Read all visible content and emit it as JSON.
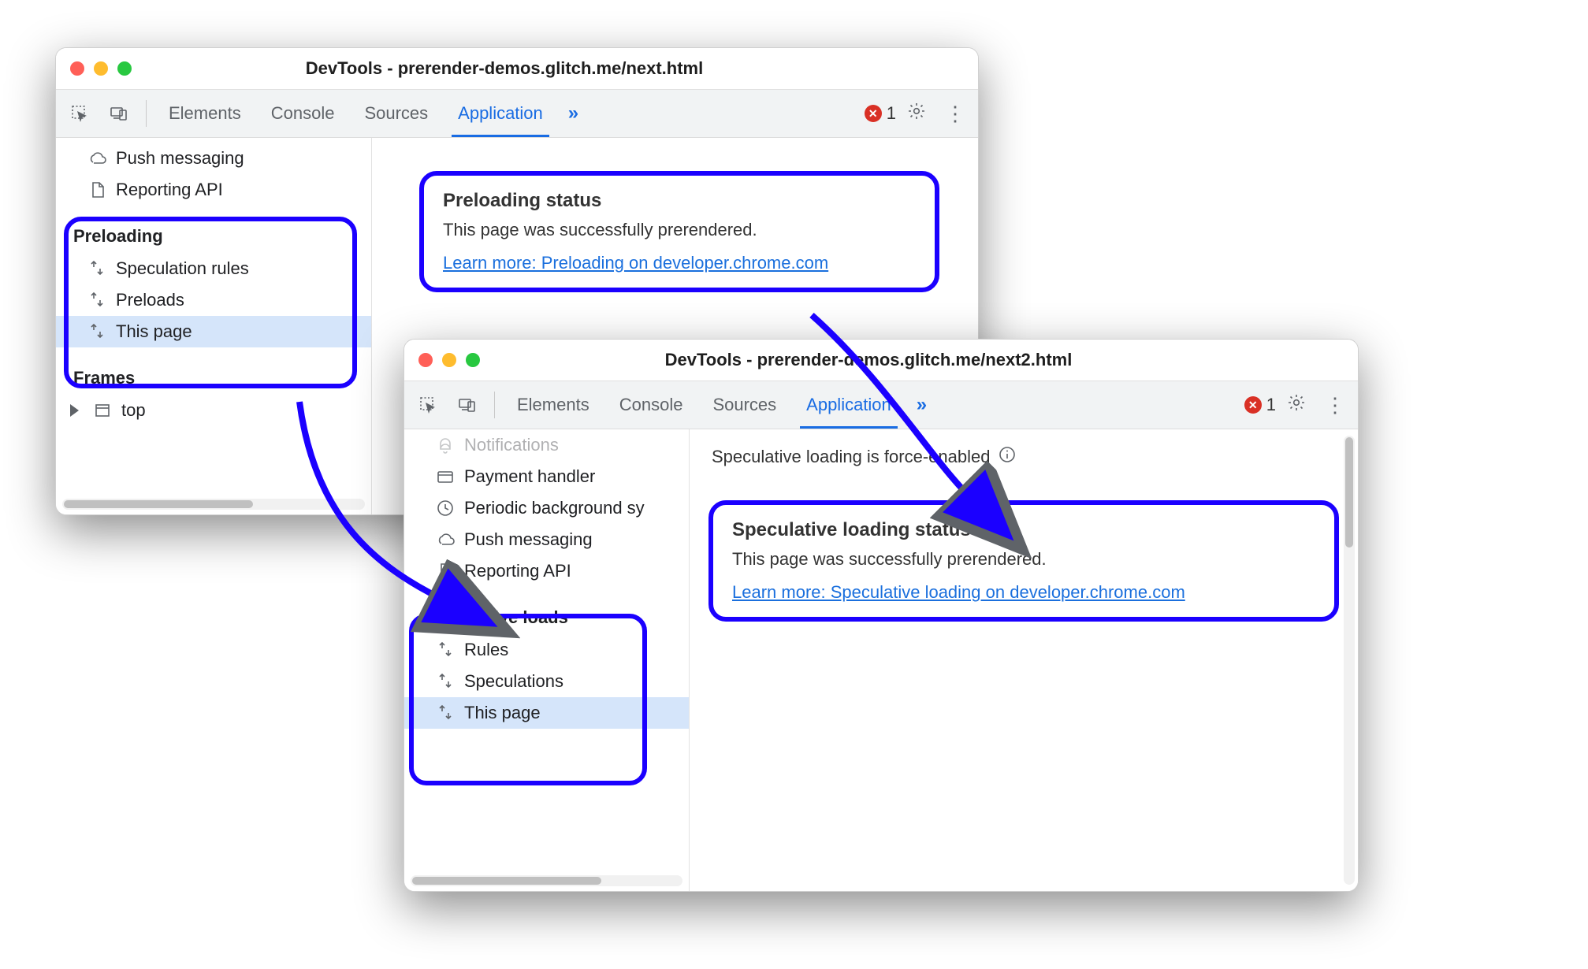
{
  "annotation_accent": "#1b00ff",
  "windows": {
    "a": {
      "title": "DevTools - prerender-demos.glitch.me/next.html",
      "tabs": {
        "t0": "Elements",
        "t1": "Console",
        "t2": "Sources",
        "t3": "Application",
        "active": "Application"
      },
      "errors": "1",
      "sidebar": {
        "top0": "Push messaging",
        "top1": "Reporting API",
        "sectionA": "Preloading",
        "a0": "Speculation rules",
        "a1": "Preloads",
        "a2": "This page",
        "sectionB": "Frames",
        "b0": "top"
      },
      "status": {
        "heading": "Preloading status",
        "body": "This page was successfully prerendered.",
        "link": "Learn more: Preloading on developer.chrome.com"
      }
    },
    "b": {
      "title": "DevTools - prerender-demos.glitch.me/next2.html",
      "tabs": {
        "t0": "Elements",
        "t1": "Console",
        "t2": "Sources",
        "t3": "Application",
        "active": "Application"
      },
      "errors": "1",
      "sidebar": {
        "top0": "Notifications",
        "top1": "Payment handler",
        "top2": "Periodic background sy",
        "top3": "Push messaging",
        "top4": "Reporting API",
        "sectionA": "Speculative loads",
        "a0": "Rules",
        "a1": "Speculations",
        "a2": "This page"
      },
      "note": "Speculative loading is force-enabled",
      "status": {
        "heading": "Speculative loading status",
        "body": "This page was successfully prerendered.",
        "link": "Learn more: Speculative loading on developer.chrome.com"
      }
    }
  }
}
